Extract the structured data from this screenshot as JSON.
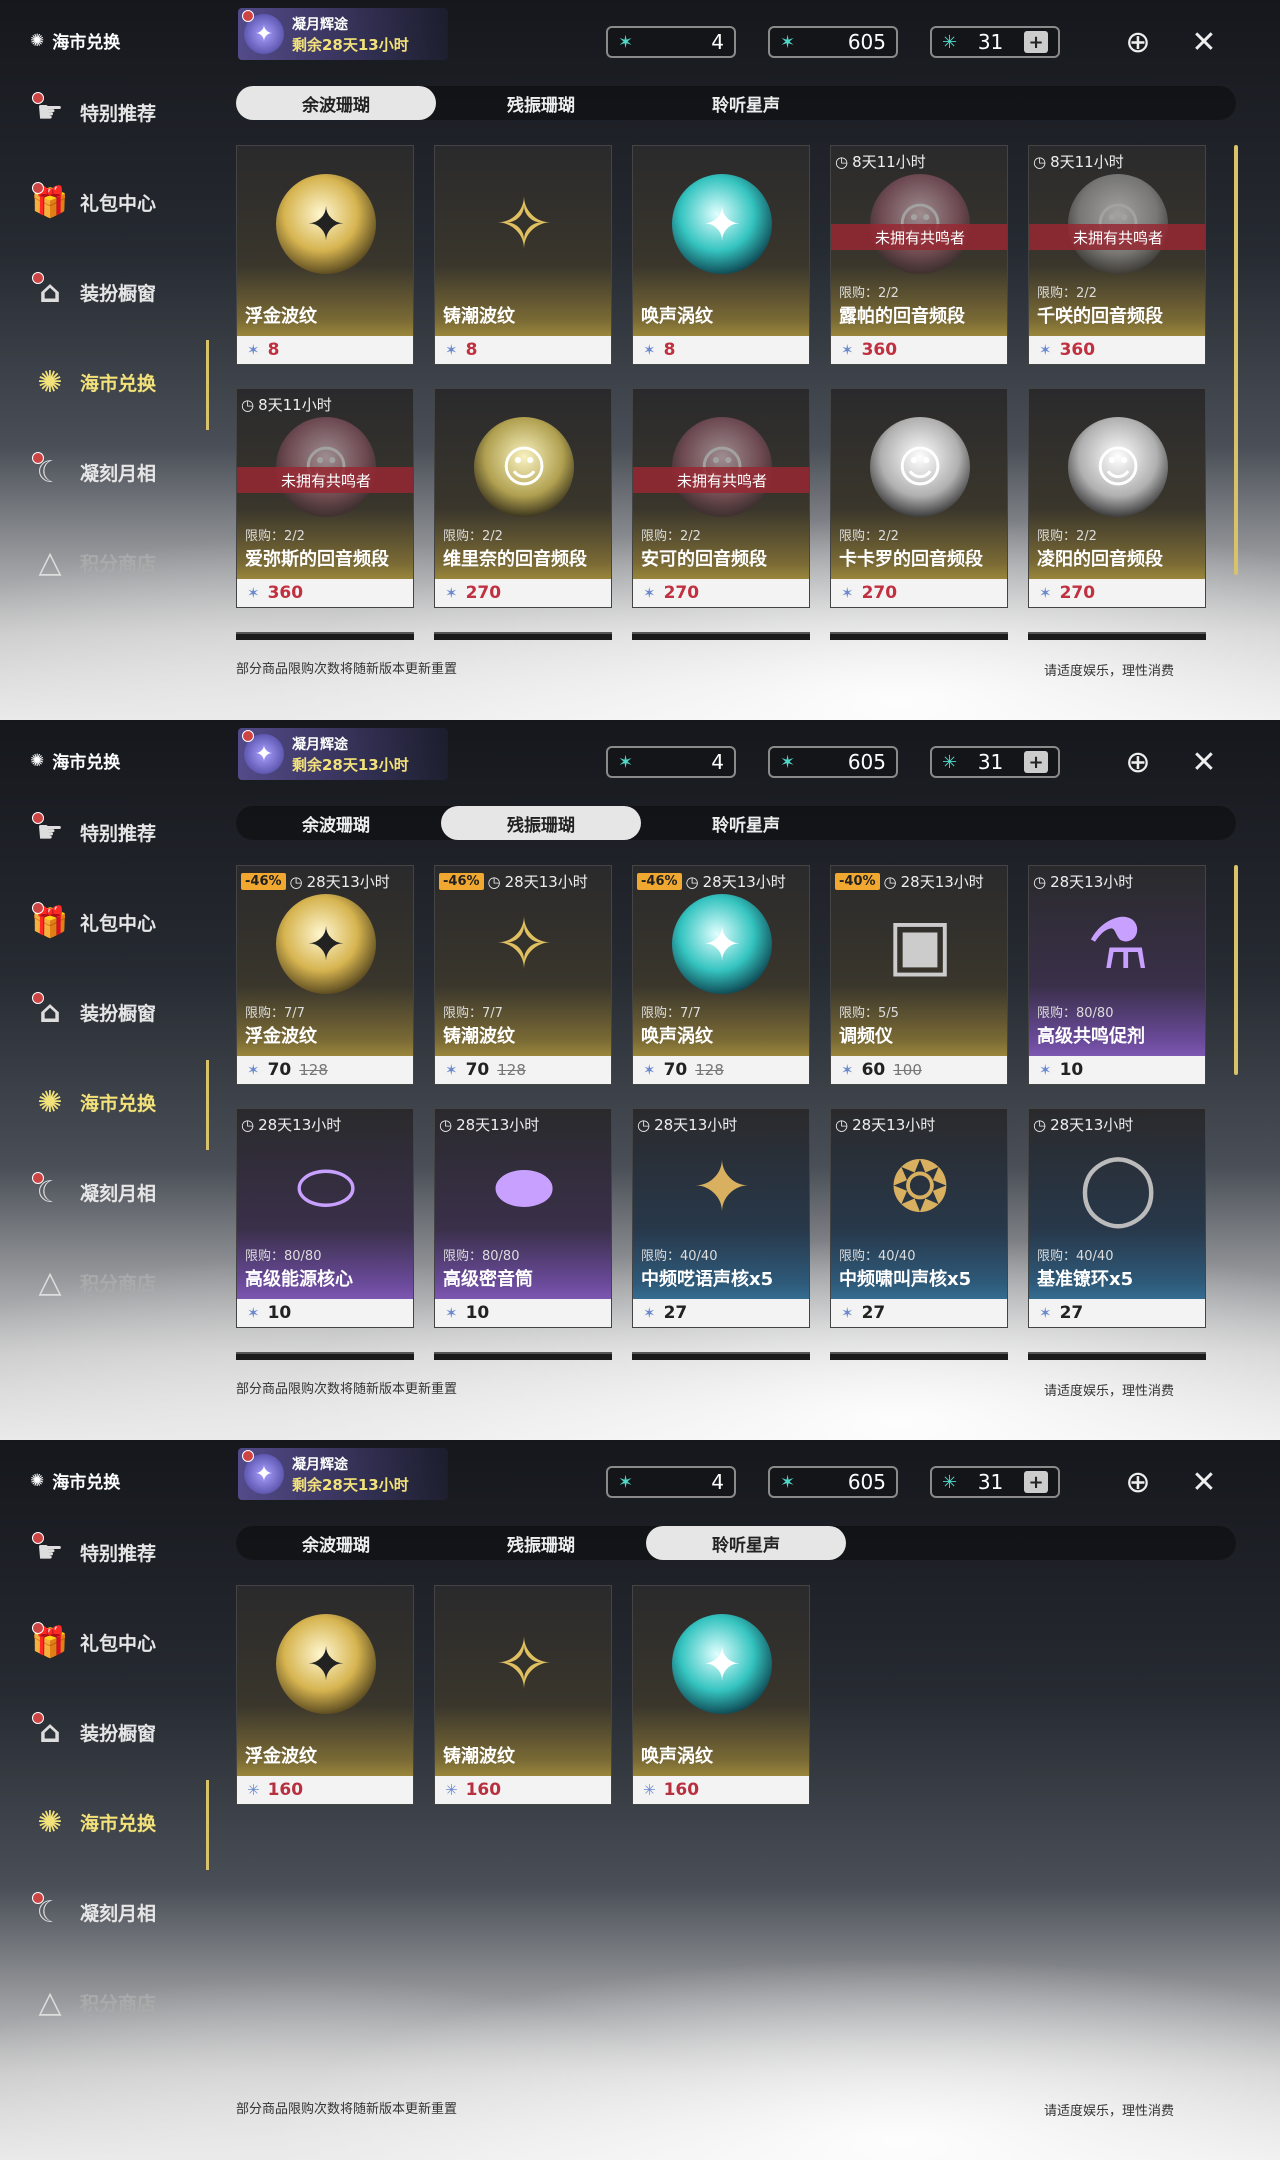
{
  "sidebar": {
    "title": "海市兑换",
    "items": [
      {
        "label": "特别推荐",
        "icon": "recommend-icon"
      },
      {
        "label": "礼包中心",
        "icon": "gift-icon"
      },
      {
        "label": "装扮橱窗",
        "icon": "wardrobe-icon"
      },
      {
        "label": "海市兑换",
        "icon": "coral-icon"
      },
      {
        "label": "凝刻月相",
        "icon": "moon-icon"
      },
      {
        "label": "积分商店",
        "icon": "points-icon"
      }
    ]
  },
  "event": {
    "line1": "凝月辉途",
    "line2": "剩余28天13小时"
  },
  "currencies": {
    "a": "4",
    "b": "605",
    "c": "31"
  },
  "tabs": [
    "余波珊瑚",
    "残振珊瑚",
    "聆听星声"
  ],
  "footer": {
    "left": "部分商品限购次数将随新版本更新重置",
    "right": "请适度娱乐，理性消费"
  },
  "panel1": {
    "cards": [
      {
        "name": "浮金波纹",
        "price": "8",
        "timer": "",
        "ribbon": "",
        "limit": ""
      },
      {
        "name": "铸潮波纹",
        "price": "8",
        "timer": "",
        "ribbon": "",
        "limit": ""
      },
      {
        "name": "唤声涡纹",
        "price": "8",
        "timer": "",
        "ribbon": "",
        "limit": ""
      },
      {
        "name": "露帕的回音频段",
        "price": "360",
        "timer": "8天11小时",
        "ribbon": "未拥有共鸣者",
        "limit": "限购：2/2"
      },
      {
        "name": "千咲的回音频段",
        "price": "360",
        "timer": "8天11小时",
        "ribbon": "未拥有共鸣者",
        "limit": "限购：2/2"
      },
      {
        "name": "爱弥斯的回音频段",
        "price": "360",
        "timer": "8天11小时",
        "ribbon": "未拥有共鸣者",
        "limit": "限购：2/2"
      },
      {
        "name": "维里奈的回音频段",
        "price": "270",
        "timer": "",
        "ribbon": "",
        "limit": "限购：2/2"
      },
      {
        "name": "安可的回音频段",
        "price": "270",
        "timer": "",
        "ribbon": "未拥有共鸣者",
        "limit": "限购：2/2"
      },
      {
        "name": "卡卡罗的回音频段",
        "price": "270",
        "timer": "",
        "ribbon": "",
        "limit": "限购：2/2"
      },
      {
        "name": "凌阳的回音频段",
        "price": "270",
        "timer": "",
        "ribbon": "",
        "limit": "限购：2/2"
      }
    ]
  },
  "panel2": {
    "cards": [
      {
        "name": "浮金波纹",
        "price": "70",
        "old": "128",
        "disc": "-46%",
        "timer": "28天13小时",
        "limit": "限购：7/7"
      },
      {
        "name": "铸潮波纹",
        "price": "70",
        "old": "128",
        "disc": "-46%",
        "timer": "28天13小时",
        "limit": "限购：7/7"
      },
      {
        "name": "唤声涡纹",
        "price": "70",
        "old": "128",
        "disc": "-46%",
        "timer": "28天13小时",
        "limit": "限购：7/7"
      },
      {
        "name": "调频仪",
        "price": "60",
        "old": "100",
        "disc": "-40%",
        "timer": "28天13小时",
        "limit": "限购：5/5"
      },
      {
        "name": "高级共鸣促剂",
        "price": "10",
        "old": "",
        "disc": "",
        "timer": "28天13小时",
        "limit": "限购：80/80"
      },
      {
        "name": "高级能源核心",
        "price": "10",
        "old": "",
        "disc": "",
        "timer": "28天13小时",
        "limit": "限购：80/80"
      },
      {
        "name": "高级密音筒",
        "price": "10",
        "old": "",
        "disc": "",
        "timer": "28天13小时",
        "limit": "限购：80/80"
      },
      {
        "name": "中频呓语声核x5",
        "price": "27",
        "old": "",
        "disc": "",
        "timer": "28天13小时",
        "limit": "限购：40/40"
      },
      {
        "name": "中频啸叫声核x5",
        "price": "27",
        "old": "",
        "disc": "",
        "timer": "28天13小时",
        "limit": "限购：40/40"
      },
      {
        "name": "基准镣环x5",
        "price": "27",
        "old": "",
        "disc": "",
        "timer": "28天13小时",
        "limit": "限购：40/40"
      }
    ]
  },
  "panel3": {
    "cards": [
      {
        "name": "浮金波纹",
        "price": "160"
      },
      {
        "name": "铸潮波纹",
        "price": "160"
      },
      {
        "name": "唤声涡纹",
        "price": "160"
      }
    ]
  }
}
